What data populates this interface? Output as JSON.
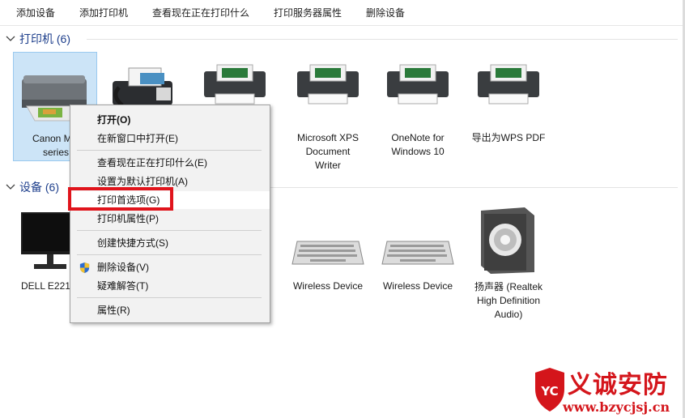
{
  "toolbar": {
    "items": [
      "添加设备",
      "添加打印机",
      "查看现在正在打印什么",
      "打印服务器属性",
      "删除设备"
    ]
  },
  "printers_group": {
    "title": "打印机 (6)"
  },
  "devices_group": {
    "title": "设备 (6)"
  },
  "printers": [
    {
      "label_line1": "Canon MG",
      "label_line2": "series",
      "icon": "inkjet-printer-icon"
    },
    {
      "label_line1": "",
      "label_line2": "",
      "icon": "fax-printer-icon"
    },
    {
      "label_line1": "t",
      "label_line2": "",
      "icon": "printer-icon"
    },
    {
      "label_line1": "Microsoft XPS",
      "label_line2": "Document",
      "label_line3": "Writer",
      "icon": "printer-icon"
    },
    {
      "label_line1": "OneNote for",
      "label_line2": "Windows 10",
      "icon": "printer-icon"
    },
    {
      "label_line1": "导出为WPS PDF",
      "icon": "printer-icon"
    }
  ],
  "devices": [
    {
      "label_line1": "DELL E221",
      "icon": "monitor-icon"
    },
    {
      "label_line1": "Wireless Device",
      "icon": "keyboard-icon"
    },
    {
      "label_line1": "Wireless Device",
      "icon": "keyboard-icon"
    },
    {
      "label_line1": "扬声器 (Realtek",
      "label_line2": "High Definition",
      "label_line3": "Audio)",
      "icon": "speaker-icon"
    }
  ],
  "context_menu": {
    "items": {
      "open": "打开(O)",
      "open_new": "在新窗口中打开(E)",
      "see_printing": "查看现在正在打印什么(E)",
      "set_default": "设置为默认打印机(A)",
      "preferences": "打印首选项(G)",
      "printer_props": "打印机属性(P)",
      "shortcut": "创建快捷方式(S)",
      "remove": "删除设备(V)",
      "troubleshoot": "疑难解答(T)",
      "properties": "属性(R)"
    }
  },
  "watermark": {
    "title": "义诚安防",
    "url": "www.bzycjsj.cn",
    "logo_text": "YC"
  },
  "colors": {
    "group_title": "#1e3f8c",
    "highlight": "#e0141c",
    "selected": "#cce4f7",
    "watermark": "#d4151b"
  }
}
